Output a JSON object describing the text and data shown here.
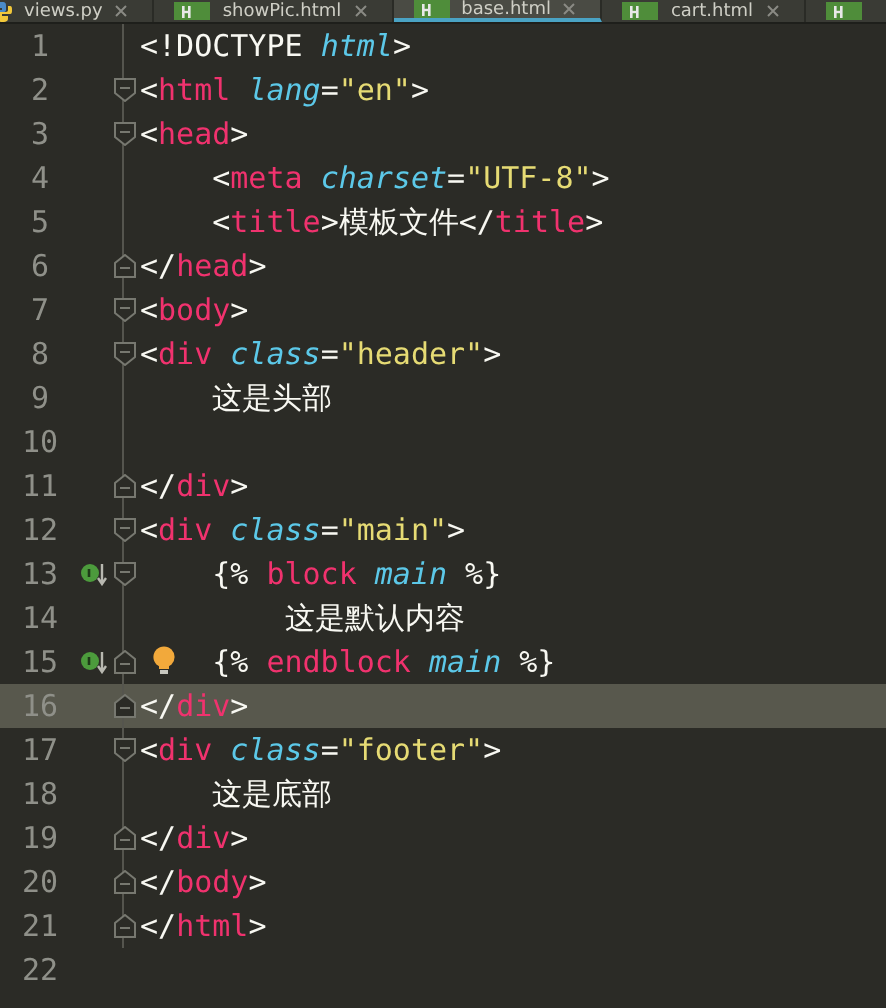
{
  "tabs": [
    {
      "kind": "python",
      "label": "views.py",
      "selected": false
    },
    {
      "kind": "html",
      "label": "showPic.html",
      "selected": false
    },
    {
      "kind": "html",
      "label": "base.html",
      "selected": true
    },
    {
      "kind": "html",
      "label": "cart.html",
      "selected": false
    },
    {
      "kind": "html",
      "selected": false
    }
  ],
  "lines": [
    {
      "number": "1",
      "tokens": [
        {
          "kind": "text",
          "text": "<!DOCTYPE "
        },
        {
          "kind": "keyword",
          "text": "html"
        },
        {
          "kind": "text",
          "text": ">"
        }
      ]
    },
    {
      "number": "2",
      "fold_start": true,
      "tokens": [
        {
          "kind": "text",
          "text": "<"
        },
        {
          "kind": "tag",
          "text": "html "
        },
        {
          "kind": "attr",
          "text": "lang"
        },
        {
          "kind": "text",
          "text": "="
        },
        {
          "kind": "string",
          "text": "\"en\""
        },
        {
          "kind": "text",
          "text": ">"
        }
      ]
    },
    {
      "number": "3",
      "fold_start": true,
      "tokens": [
        {
          "kind": "text",
          "text": "<"
        },
        {
          "kind": "tag",
          "text": "head"
        },
        {
          "kind": "text",
          "text": ">"
        }
      ]
    },
    {
      "number": "4",
      "tokens": [
        {
          "kind": "text",
          "text": "    <"
        },
        {
          "kind": "tag",
          "text": "meta "
        },
        {
          "kind": "attr",
          "text": "charset"
        },
        {
          "kind": "text",
          "text": "="
        },
        {
          "kind": "string",
          "text": "\"UTF-8\""
        },
        {
          "kind": "text",
          "text": ">"
        }
      ]
    },
    {
      "number": "5",
      "tokens": [
        {
          "kind": "text",
          "text": "    <"
        },
        {
          "kind": "tag",
          "text": "title"
        },
        {
          "kind": "text",
          "text": ">模板文件</"
        },
        {
          "kind": "tag",
          "text": "title"
        },
        {
          "kind": "text",
          "text": ">"
        }
      ]
    },
    {
      "number": "6",
      "fold_end": true,
      "tokens": [
        {
          "kind": "text",
          "text": "</"
        },
        {
          "kind": "tag",
          "text": "head"
        },
        {
          "kind": "text",
          "text": ">"
        }
      ]
    },
    {
      "number": "7",
      "fold_start": true,
      "tokens": [
        {
          "kind": "text",
          "text": "<"
        },
        {
          "kind": "tag",
          "text": "body"
        },
        {
          "kind": "text",
          "text": ">"
        }
      ]
    },
    {
      "number": "8",
      "fold_start": true,
      "tokens": [
        {
          "kind": "text",
          "text": "<"
        },
        {
          "kind": "tag",
          "text": "div "
        },
        {
          "kind": "attr",
          "text": "class"
        },
        {
          "kind": "text",
          "text": "="
        },
        {
          "kind": "string",
          "text": "\"header\""
        },
        {
          "kind": "text",
          "text": ">"
        }
      ]
    },
    {
      "number": "9",
      "tokens": [
        {
          "kind": "text",
          "text": "    这是头部"
        }
      ]
    },
    {
      "number": "10"
    },
    {
      "number": "11",
      "fold_end": true,
      "tokens": [
        {
          "kind": "text",
          "text": "</"
        },
        {
          "kind": "tag",
          "text": "div"
        },
        {
          "kind": "text",
          "text": ">"
        }
      ]
    },
    {
      "number": "12",
      "fold_start": true,
      "tokens": [
        {
          "kind": "text",
          "text": "<"
        },
        {
          "kind": "tag",
          "text": "div "
        },
        {
          "kind": "attr",
          "text": "class"
        },
        {
          "kind": "text",
          "text": "="
        },
        {
          "kind": "string",
          "text": "\"main\""
        },
        {
          "kind": "text",
          "text": ">"
        }
      ]
    },
    {
      "number": "13",
      "fold_start": true,
      "override": true,
      "tokens": [
        {
          "kind": "text",
          "text": "    {% "
        },
        {
          "kind": "tag",
          "text": "block "
        },
        {
          "kind": "attr",
          "text": "main"
        },
        {
          "kind": "text",
          "text": " %}"
        }
      ]
    },
    {
      "number": "14",
      "tokens": [
        {
          "kind": "text",
          "text": "        这是默认内容"
        }
      ]
    },
    {
      "number": "15",
      "fold_end": true,
      "override": true,
      "bulb": true,
      "tokens": [
        {
          "kind": "text",
          "text": "    {% "
        },
        {
          "kind": "tag",
          "text": "endblock "
        },
        {
          "kind": "attr",
          "text": "main"
        },
        {
          "kind": "text",
          "text": " %}"
        }
      ]
    },
    {
      "number": "16",
      "fold_end": true,
      "current": true,
      "tokens": [
        {
          "kind": "text",
          "text": "</"
        },
        {
          "kind": "tag",
          "text": "div"
        },
        {
          "kind": "text",
          "text": ">"
        }
      ]
    },
    {
      "number": "17",
      "fold_start": true,
      "tokens": [
        {
          "kind": "text",
          "text": "<"
        },
        {
          "kind": "tag",
          "text": "div "
        },
        {
          "kind": "attr",
          "text": "class"
        },
        {
          "kind": "text",
          "text": "="
        },
        {
          "kind": "string",
          "text": "\"footer\""
        },
        {
          "kind": "text",
          "text": ">"
        }
      ]
    },
    {
      "number": "18",
      "tokens": [
        {
          "kind": "text",
          "text": "    这是底部"
        }
      ]
    },
    {
      "number": "19",
      "fold_end": true,
      "tokens": [
        {
          "kind": "text",
          "text": "</"
        },
        {
          "kind": "tag",
          "text": "div"
        },
        {
          "kind": "text",
          "text": ">"
        }
      ]
    },
    {
      "number": "20",
      "fold_end": true,
      "tokens": [
        {
          "kind": "text",
          "text": "</"
        },
        {
          "kind": "tag",
          "text": "body"
        },
        {
          "kind": "text",
          "text": ">"
        }
      ]
    },
    {
      "number": "21",
      "fold_end": true,
      "tokens": [
        {
          "kind": "text",
          "text": "</"
        },
        {
          "kind": "tag",
          "text": "html"
        },
        {
          "kind": "text",
          "text": ">"
        }
      ]
    },
    {
      "number": "22"
    }
  ]
}
